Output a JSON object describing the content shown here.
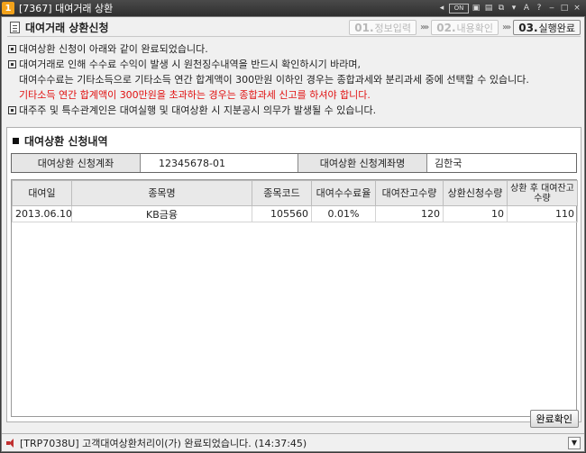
{
  "window": {
    "number": "1",
    "title": "[7367] 대여거래 상환",
    "controls": [
      "◂",
      "ON",
      "▣",
      "▤",
      "⧉",
      "▾",
      "A",
      "?",
      "‒",
      "□",
      "×"
    ]
  },
  "header": {
    "title": "대여거래 상환신청",
    "steps": [
      {
        "num": "01.",
        "label": "정보입력"
      },
      {
        "num": "02.",
        "label": "내용확인"
      },
      {
        "num": "03.",
        "label": "실행완료"
      }
    ],
    "separator": "»»"
  },
  "notices": [
    "대여상환 신청이 아래와 같이 완료되었습니다.",
    "대여거래로 인해 수수료 수익이 발생 시 원천징수내역을 반드시 확인하시기 바라며,",
    "대여수수료는 기타소득으로 기타소득 연간 합계액이 300만원 이하인 경우는 종합과세와 분리과세 중에 선택할 수 있습니다.",
    "기타소득 연간 합계액이 300만원을 초과하는 경우는 종합과세 신고를 하셔야 합니다.",
    "대주주 및 특수관계인은 대여실행 및 대여상환 시 지분공시 의무가 발생될 수 있습니다."
  ],
  "detail": {
    "section_title": "대여상환 신청내역",
    "account_label": "대여상환 신청계좌",
    "account_value": "12345678-01",
    "account_name_label": "대여상환 신청계좌명",
    "account_name_value": "김한국",
    "columns": [
      "대여일",
      "종목명",
      "종목코드",
      "대여수수료율",
      "대여잔고수량",
      "상환신청수량",
      "상환 후 대여잔고수량"
    ],
    "rows": [
      [
        "2013.06.10",
        "KB금융",
        "105560",
        "0.01%",
        "120",
        "10",
        "110"
      ]
    ]
  },
  "confirm_label": "완료확인",
  "status": {
    "message": "[TRP7038U] 고객대여상환처리이(가) 완료되었습니다. (14:37:45)"
  },
  "colors": {
    "warning": "#e01010",
    "app_badge": "#f2a21a",
    "titlebar": "#3a3a3a"
  }
}
